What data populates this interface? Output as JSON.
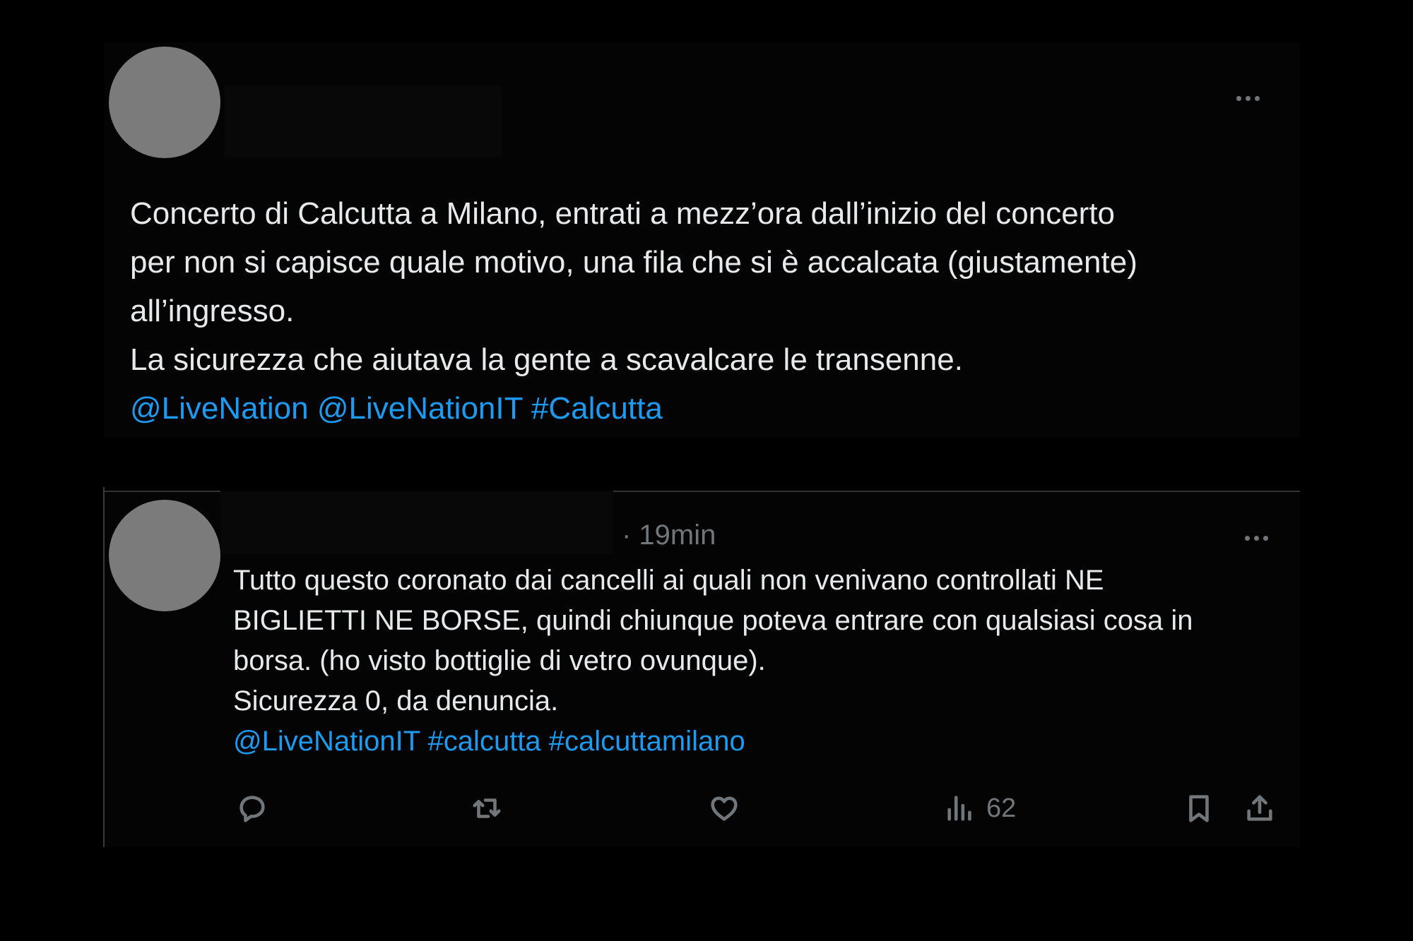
{
  "tweet": {
    "lines": [
      "Concerto di Calcutta a Milano, entrati a mezz’ora dall’inizio del concerto",
      "per non si capisce quale motivo, una fila che si è accalcata (giustamente)",
      "all’ingresso.",
      "La sicurezza che aiutava la gente a  scavalcare le transenne."
    ],
    "tags": [
      "@LiveNation",
      "@LiveNationIT",
      "#Calcutta"
    ]
  },
  "reply": {
    "time": "· 19min",
    "lines": [
      "Tutto questo coronato dai cancelli ai quali non venivano controllati NE",
      "BIGLIETTI NE BORSE, quindi chiunque poteva entrare con qualsiasi cosa in",
      "borsa. (ho visto bottiglie di vetro ovunque).",
      "Sicurezza 0, da denuncia."
    ],
    "tags": [
      "@LiveNationIT",
      "#calcutta",
      "#calcuttamilano"
    ],
    "actions": {
      "reply_icon": "speech-bubble-icon",
      "retweet_icon": "retweet-icon",
      "like_icon": "heart-icon",
      "views_icon": "bar-chart-icon",
      "views_count": "62",
      "bookmark_icon": "bookmark-icon",
      "share_icon": "share-upload-icon"
    }
  },
  "colors": {
    "background": "#000000",
    "text": "#e7e9ea",
    "link": "#1d9bf0",
    "muted": "#71767b",
    "avatar": "#7b7b7b"
  }
}
